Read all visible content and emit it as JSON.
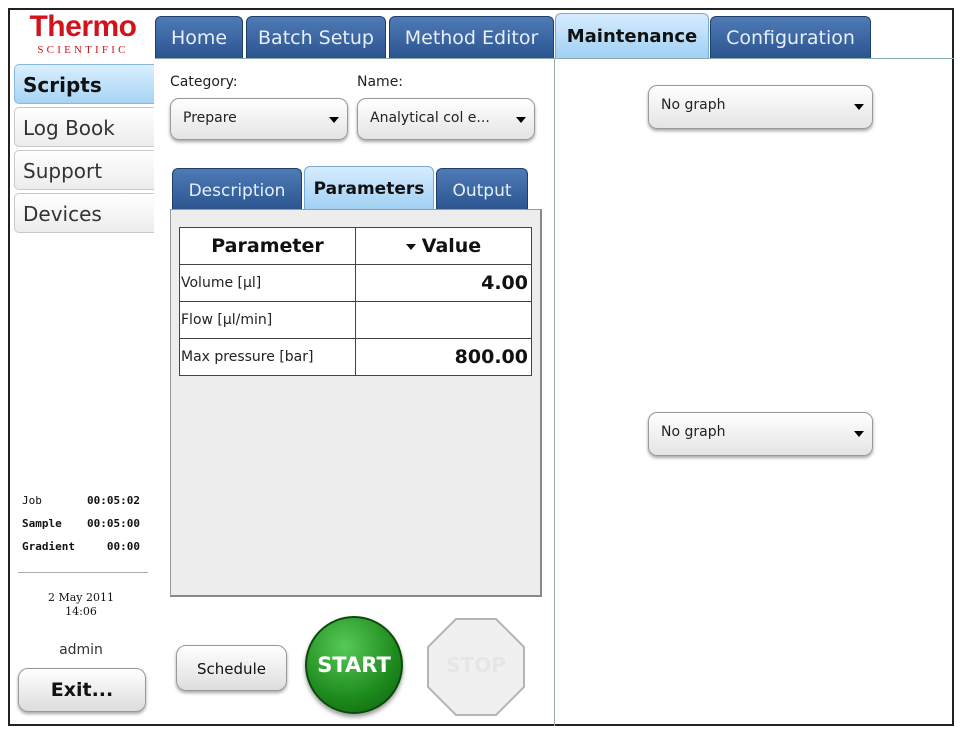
{
  "brand": {
    "name": "Thermo",
    "sub": "SCIENTIFIC"
  },
  "top_tabs": [
    {
      "label": "Home",
      "active": false
    },
    {
      "label": "Batch Setup",
      "active": false
    },
    {
      "label": "Method Editor",
      "active": false
    },
    {
      "label": "Maintenance",
      "active": true
    },
    {
      "label": "Configuration",
      "active": false
    }
  ],
  "sidebar": {
    "items": [
      {
        "label": "Scripts",
        "active": true
      },
      {
        "label": "Log Book",
        "active": false
      },
      {
        "label": "Support",
        "active": false
      },
      {
        "label": "Devices",
        "active": false
      }
    ],
    "timers": [
      {
        "label": "Job",
        "value": "00:05:02"
      },
      {
        "label": "Sample",
        "value": "00:05:00"
      },
      {
        "label": "Gradient",
        "value": "00:00"
      }
    ],
    "date": "2 May 2011",
    "time": "14:06",
    "user": "admin",
    "exit_label": "Exit..."
  },
  "selectors": {
    "category_label": "Category:",
    "category_value": "Prepare",
    "name_label": "Name:",
    "name_value": "Analytical col e..."
  },
  "sub_tabs": [
    {
      "label": "Description",
      "active": false
    },
    {
      "label": "Parameters",
      "active": true
    },
    {
      "label": "Output",
      "active": false
    }
  ],
  "params_table": {
    "headers": [
      "Parameter",
      "Value"
    ],
    "rows": [
      {
        "param": "Volume [µl]",
        "value": "4.00"
      },
      {
        "param": "Flow [µl/min]",
        "value": ""
      },
      {
        "param": "Max pressure [bar]",
        "value": "800.00"
      }
    ]
  },
  "buttons": {
    "schedule": "Schedule",
    "start": "START",
    "stop": "STOP"
  },
  "graphs": {
    "top_value": "No graph",
    "bottom_value": "No graph"
  },
  "colors": {
    "brand_red": "#d2131b",
    "tab_blue": "#2c5590",
    "tab_active": "#9fd0f3",
    "start_green": "#1d8a1d"
  }
}
